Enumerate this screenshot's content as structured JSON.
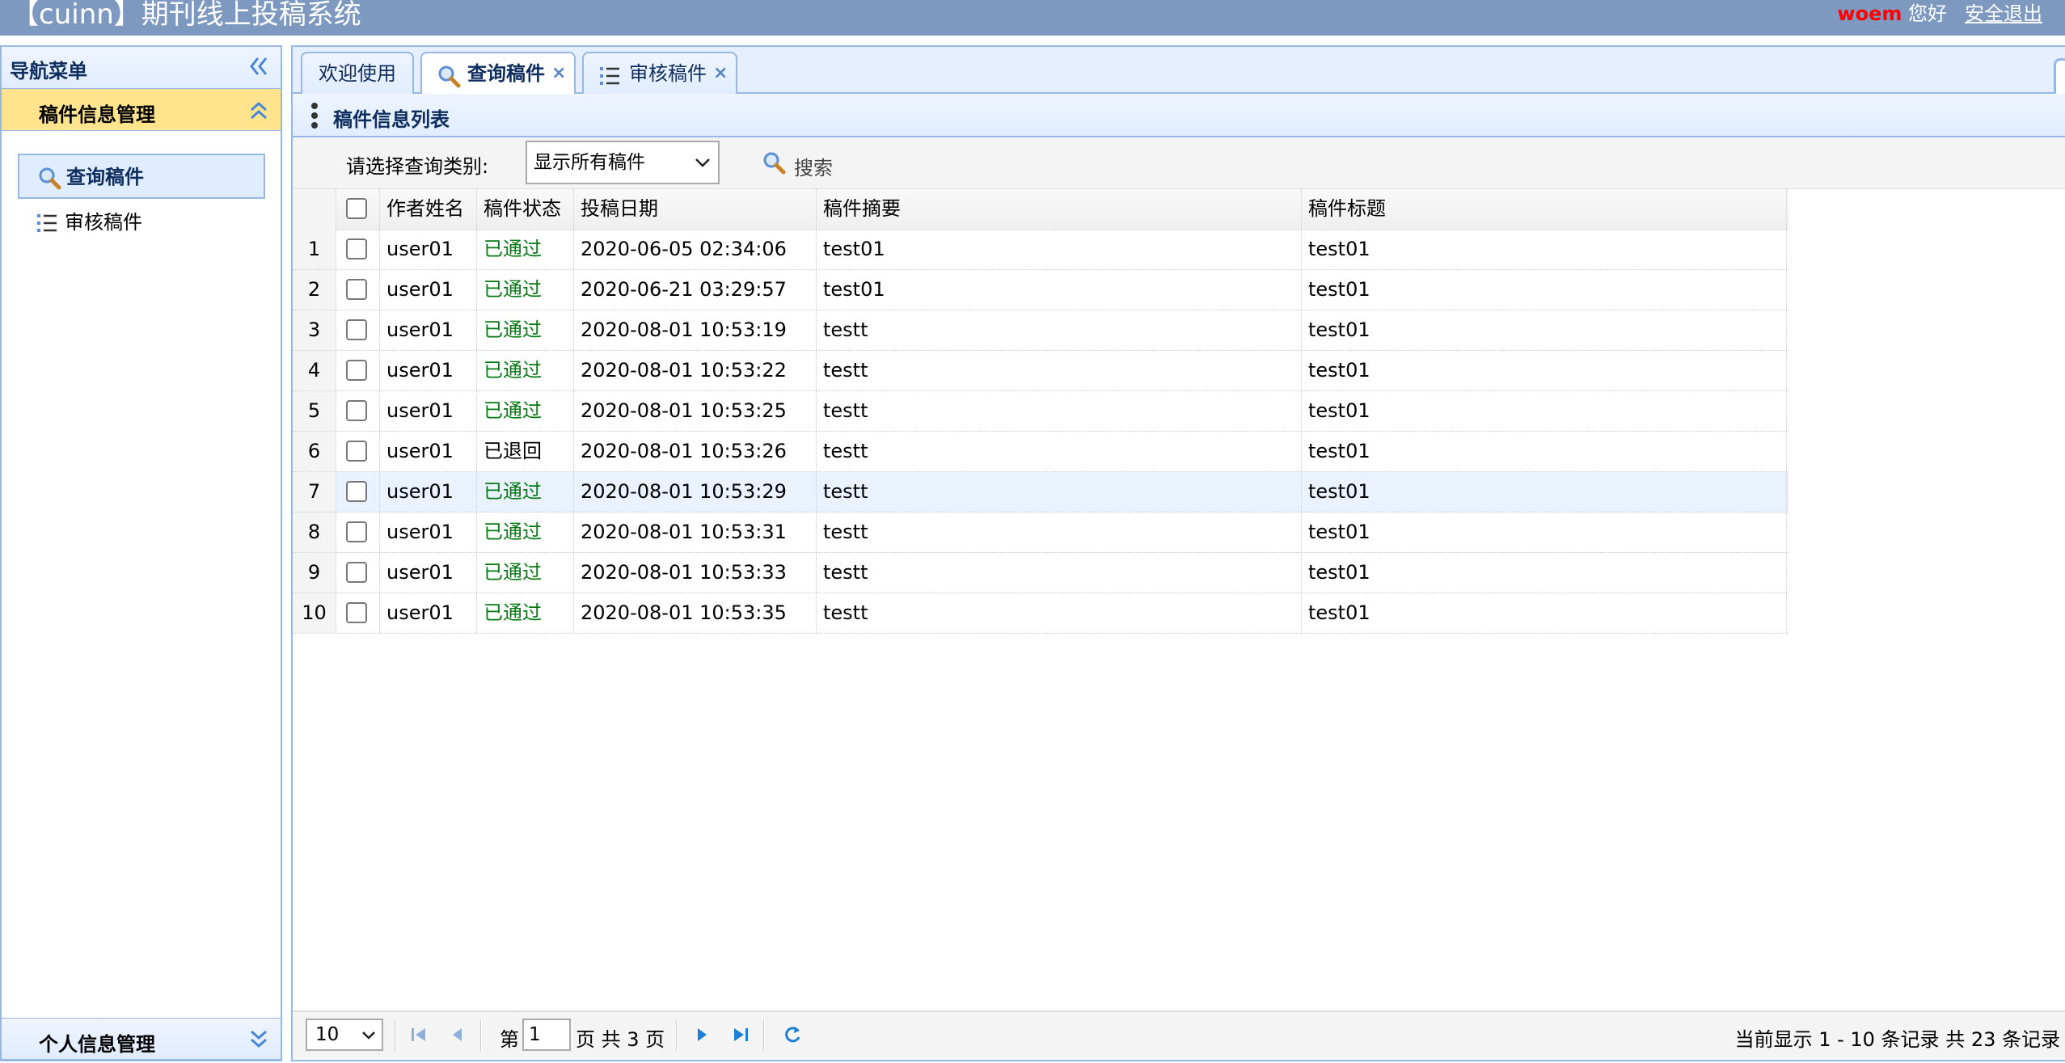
{
  "header": {
    "app_title": "【cuinn】期刊线上投稿系统",
    "user_name": "woem",
    "greeting": " 您好",
    "logout": "安全退出"
  },
  "sidebar": {
    "title": "导航菜单",
    "section_manuscript": "稿件信息管理",
    "items": [
      {
        "label": "查询稿件",
        "icon": "search-icon"
      },
      {
        "label": "审核稿件",
        "icon": "list-icon"
      }
    ],
    "section_personal": "个人信息管理"
  },
  "tabs": [
    {
      "label": "欢迎使用"
    },
    {
      "label": "查询稿件",
      "close": "×"
    },
    {
      "label": "审核稿件",
      "close": "×"
    }
  ],
  "panel": {
    "title": "稿件信息列表",
    "query_label": "请选择查询类别:",
    "query_value": "显示所有稿件",
    "search_label": "搜索"
  },
  "grid": {
    "columns": [
      "作者姓名",
      "稿件状态",
      "投稿日期",
      "稿件摘要",
      "稿件标题"
    ],
    "rows": [
      {
        "num": "1",
        "author": "user01",
        "status": "已通过",
        "date": "2020-06-05 02:34:06",
        "summary": "test01",
        "title": "test01"
      },
      {
        "num": "2",
        "author": "user01",
        "status": "已通过",
        "date": "2020-06-21 03:29:57",
        "summary": "test01",
        "title": "test01"
      },
      {
        "num": "3",
        "author": "user01",
        "status": "已通过",
        "date": "2020-08-01 10:53:19",
        "summary": "testt",
        "title": "test01"
      },
      {
        "num": "4",
        "author": "user01",
        "status": "已通过",
        "date": "2020-08-01 10:53:22",
        "summary": "testt",
        "title": "test01"
      },
      {
        "num": "5",
        "author": "user01",
        "status": "已通过",
        "date": "2020-08-01 10:53:25",
        "summary": "testt",
        "title": "test01"
      },
      {
        "num": "6",
        "author": "user01",
        "status": "已退回",
        "date": "2020-08-01 10:53:26",
        "summary": "testt",
        "title": "test01"
      },
      {
        "num": "7",
        "author": "user01",
        "status": "已通过",
        "date": "2020-08-01 10:53:29",
        "summary": "testt",
        "title": "test01"
      },
      {
        "num": "8",
        "author": "user01",
        "status": "已通过",
        "date": "2020-08-01 10:53:31",
        "summary": "testt",
        "title": "test01"
      },
      {
        "num": "9",
        "author": "user01",
        "status": "已通过",
        "date": "2020-08-01 10:53:33",
        "summary": "testt",
        "title": "test01"
      },
      {
        "num": "10",
        "author": "user01",
        "status": "已通过",
        "date": "2020-08-01 10:53:35",
        "summary": "testt",
        "title": "test01"
      }
    ]
  },
  "pager": {
    "page_size": "10",
    "page_prefix": "第",
    "current_page": "1",
    "page_suffix": "页 共 3 页",
    "info": "当前显示 1 - 10 条记录 共 23 条记录"
  },
  "colors": {
    "topbar": "#7e99c0",
    "border": "#95b8e7",
    "accordion_active": "#ffe48d",
    "status_pass": "#077a15",
    "username": "#ff0000"
  }
}
